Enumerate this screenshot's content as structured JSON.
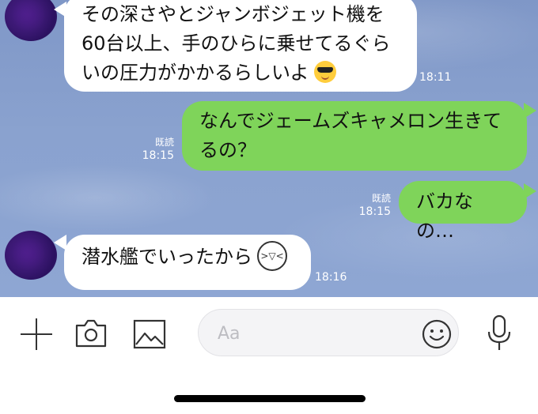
{
  "messages": [
    {
      "side": "left",
      "lines": [
        "その深さやとジャンボジェット機を",
        "60台以上、手のひらに乗せてるぐら",
        "いの圧力がかかるらしいよ"
      ],
      "emoji": "smiling-face-with-sunglasses",
      "time": "18:11"
    },
    {
      "side": "right",
      "lines": [
        "なんでジェームズキャメロン生きて",
        "るの？"
      ],
      "read": "既読",
      "time": "18:15"
    },
    {
      "side": "right",
      "lines": [
        "バカなの…"
      ],
      "read": "既読",
      "time": "18:15"
    },
    {
      "side": "left",
      "lines": [
        "潜水艦でいったから"
      ],
      "emoji": "laughing-face-sticker",
      "time": "18:16"
    }
  ],
  "input": {
    "placeholder": "Aa"
  },
  "icons": {
    "add": "plus-icon",
    "camera": "camera-icon",
    "image": "image-icon",
    "emoji": "emoji-icon",
    "mic": "microphone-icon"
  }
}
